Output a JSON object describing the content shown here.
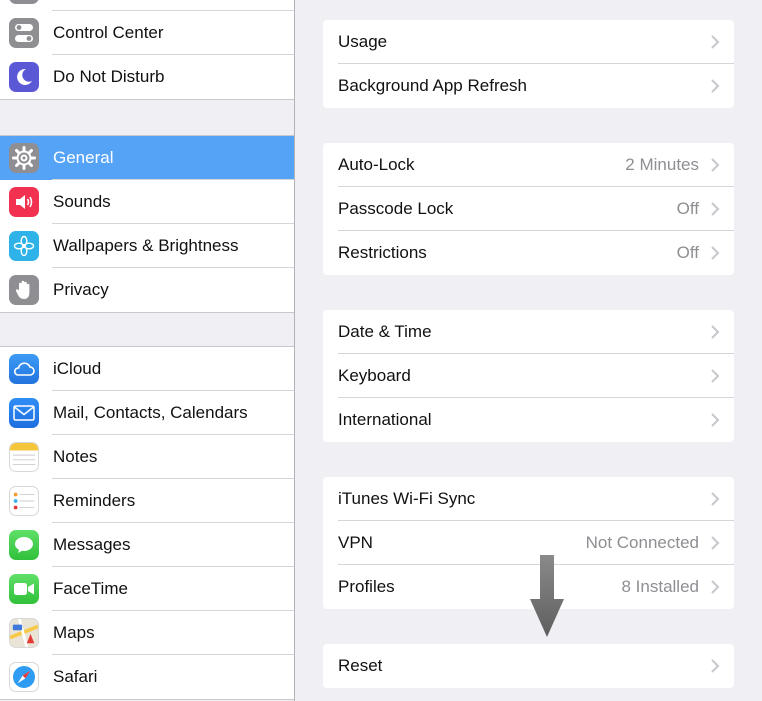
{
  "colors": {
    "selected": "#54a3f7",
    "background": "#efeff4",
    "value_gray": "#8e8e93"
  },
  "sidebar": {
    "groups": [
      {
        "items": [
          {
            "label": "Control Center",
            "icon": "control-center-icon"
          },
          {
            "label": "Do Not Disturb",
            "icon": "moon-icon"
          }
        ]
      },
      {
        "items": [
          {
            "label": "General",
            "icon": "gear-icon",
            "selected": true
          },
          {
            "label": "Sounds",
            "icon": "speaker-icon"
          },
          {
            "label": "Wallpapers & Brightness",
            "icon": "flower-icon"
          },
          {
            "label": "Privacy",
            "icon": "hand-icon"
          }
        ]
      },
      {
        "items": [
          {
            "label": "iCloud",
            "icon": "cloud-icon"
          },
          {
            "label": "Mail, Contacts, Calendars",
            "icon": "envelope-icon"
          },
          {
            "label": "Notes",
            "icon": "notes-icon"
          },
          {
            "label": "Reminders",
            "icon": "reminders-icon"
          },
          {
            "label": "Messages",
            "icon": "speech-bubble-icon"
          },
          {
            "label": "FaceTime",
            "icon": "video-camera-icon"
          },
          {
            "label": "Maps",
            "icon": "map-icon"
          },
          {
            "label": "Safari",
            "icon": "compass-icon"
          }
        ]
      }
    ]
  },
  "main": {
    "groups": [
      {
        "rows": [
          {
            "label": "Usage",
            "value": ""
          },
          {
            "label": "Background App Refresh",
            "value": ""
          }
        ]
      },
      {
        "rows": [
          {
            "label": "Auto-Lock",
            "value": "2 Minutes"
          },
          {
            "label": "Passcode Lock",
            "value": "Off"
          },
          {
            "label": "Restrictions",
            "value": "Off"
          }
        ]
      },
      {
        "rows": [
          {
            "label": "Date & Time",
            "value": ""
          },
          {
            "label": "Keyboard",
            "value": ""
          },
          {
            "label": "International",
            "value": ""
          }
        ]
      },
      {
        "rows": [
          {
            "label": "iTunes Wi-Fi Sync",
            "value": ""
          },
          {
            "label": "VPN",
            "value": "Not Connected"
          },
          {
            "label": "Profiles",
            "value": "8 Installed"
          }
        ]
      },
      {
        "rows": [
          {
            "label": "Reset",
            "value": ""
          }
        ]
      }
    ]
  }
}
